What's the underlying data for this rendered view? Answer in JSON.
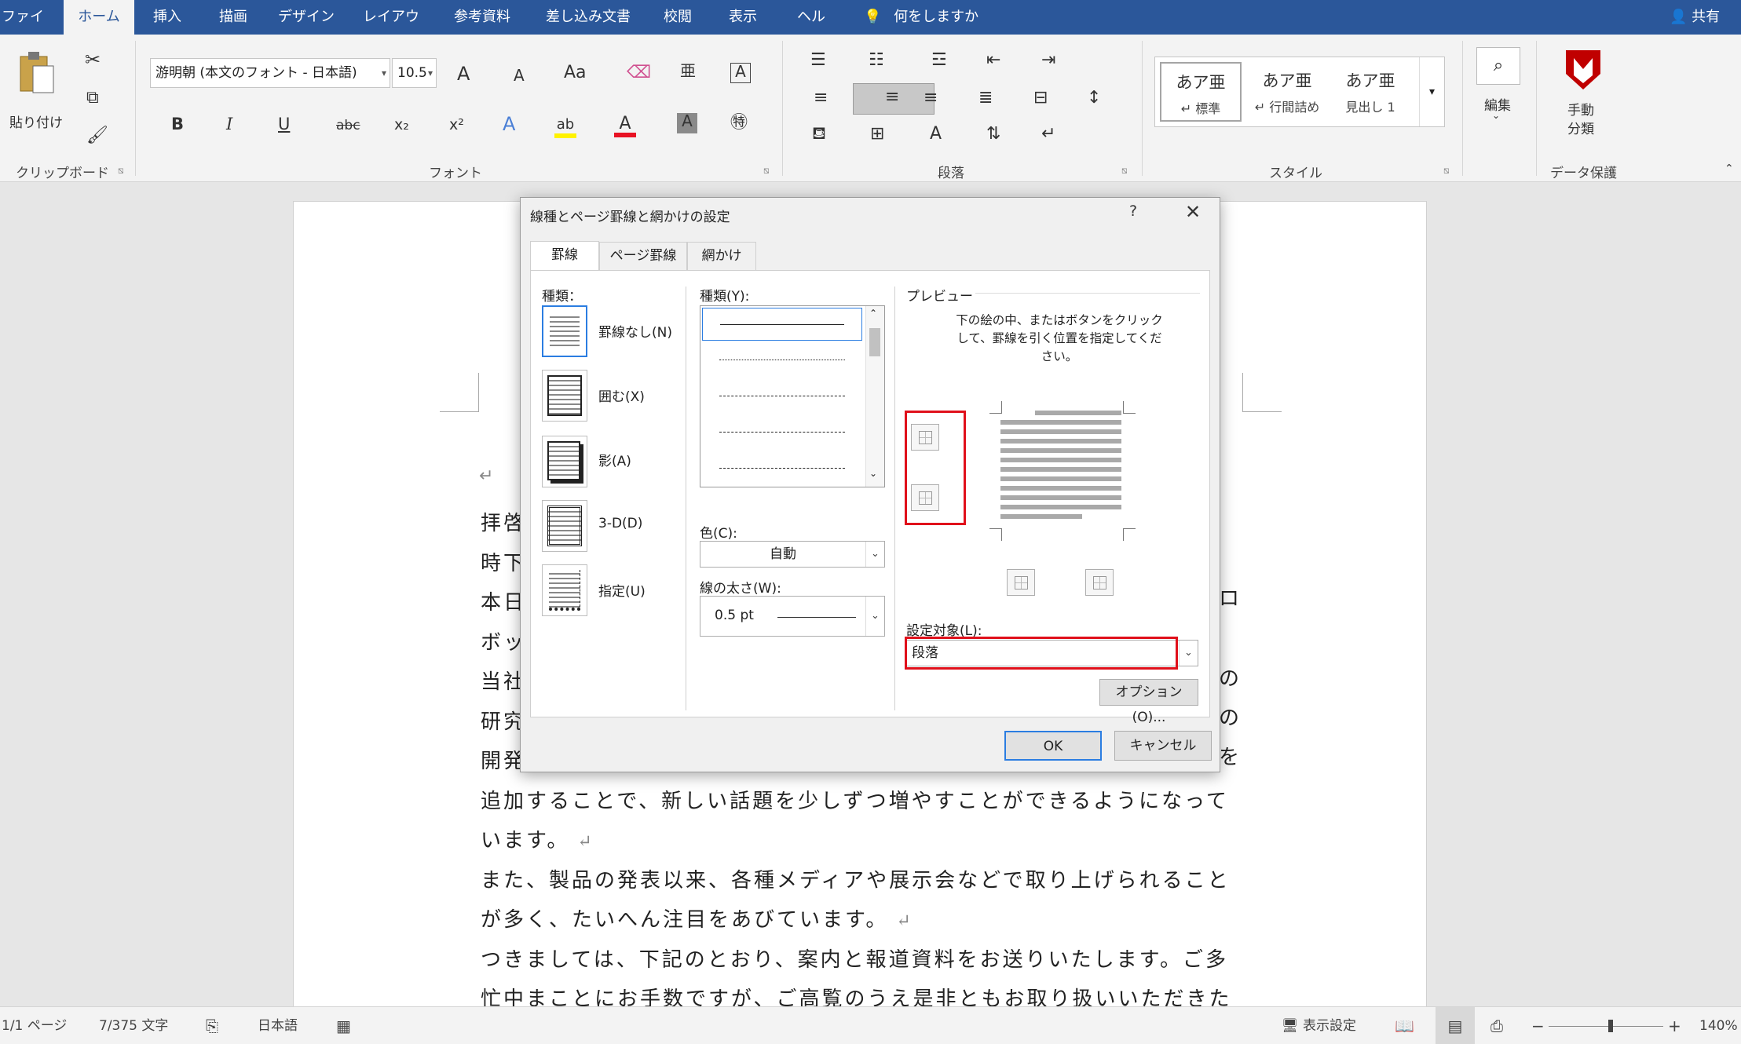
{
  "ribbon_tabs": [
    "ファイル",
    "ホーム",
    "挿入",
    "描画",
    "デザイン",
    "レイアウト",
    "参考資料",
    "差し込み文書",
    "校閲",
    "表示",
    "ヘルプ"
  ],
  "active_tab": "ホーム",
  "tell_me": "何をしますか",
  "share": "共有",
  "clipboard": {
    "paste": "貼り付け",
    "group": "クリップボード"
  },
  "font": {
    "name": "游明朝 (本文のフォント - 日本語)",
    "size": "10.5",
    "group": "フォント",
    "bold": "B",
    "italic": "I",
    "underline": "U",
    "strike": "abc",
    "subscript": "x₂",
    "superscript": "x²",
    "grow": "A",
    "shrink": "A",
    "case": "Aa",
    "color_accent": "#e81123",
    "highlight_accent": "#fff200"
  },
  "paragraph": {
    "group": "段落"
  },
  "styles": {
    "group": "スタイル",
    "items": [
      {
        "sample": "あア亜",
        "name": "↵ 標準"
      },
      {
        "sample": "あア亜",
        "name": "↵ 行間詰め"
      },
      {
        "sample": "あア亜",
        "name": "見出し 1"
      }
    ]
  },
  "editing": {
    "label": "編集"
  },
  "protection": {
    "label1": "手動",
    "label2": "分類",
    "group": "データ保護",
    "color": "#c00000"
  },
  "document": {
    "first_line": "拝啓",
    "lines": [
      "時下",
      "本日",
      "ボッ",
      "当社",
      "研究",
      "開発",
      "追加することで、新しい話題を少しずつ増やすことができるようになって",
      "います。",
      "また、製品の発表以来、各種メディアや展示会などで取り上げられること",
      "が多く、たいへん注目をあびています。",
      "つきましては、下記のとおり、案内と報道資料をお送りいたします。ご多",
      "忙中まことにお手数ですが、ご高覧のうえ是非ともお取り扱いいただきた"
    ],
    "right_edge": [
      "ロ",
      "の",
      "の",
      "を"
    ]
  },
  "status": {
    "page": "1/1 ページ",
    "words": "7/375 文字",
    "lang": "日本語",
    "view": "表示設定",
    "zoom": "140%"
  },
  "dialog": {
    "title": "線種とページ罫線と網かけの設定",
    "help": "?",
    "close": "✕",
    "tabs": [
      "罫線",
      "ページ罫線",
      "網かけ"
    ],
    "setting_label": "種類：",
    "settings": [
      "罫線なし(N)",
      "囲む(X)",
      "影(A)",
      "3-D(D)",
      "指定(U)"
    ],
    "style_label": "種類(Y):",
    "color_label": "色(C):",
    "color_value": "自動",
    "width_label": "線の太さ(W):",
    "width_value": "0.5 pt",
    "preview_label": "プレビュー",
    "preview_instruction": "下の絵の中、またはボタンをクリックして、罫線を引く位置を指定してください。",
    "apply_label": "設定対象(L):",
    "apply_value": "段落",
    "options": "オプション(O)...",
    "ok": "OK",
    "cancel": "キャンセル"
  }
}
